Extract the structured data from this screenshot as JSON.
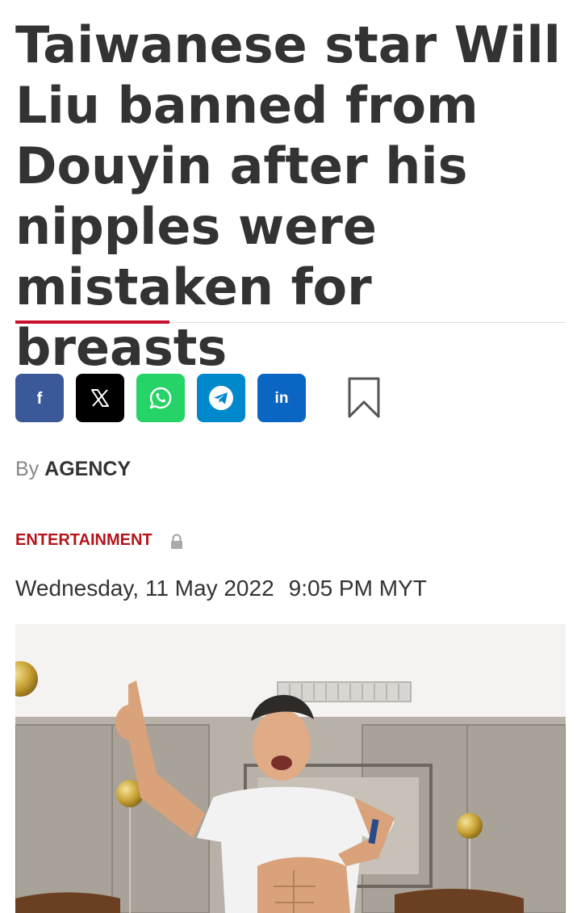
{
  "article": {
    "headline": "Taiwanese star Will Liu banned from Douyin after his nipples were mistaken for breasts",
    "byline_prefix": "By",
    "author": "AGENCY",
    "category": "ENTERTAINMENT",
    "date": "Wednesday, 11 May 2022",
    "time": "9:05 PM MYT"
  },
  "share": {
    "buttons": [
      {
        "name": "facebook",
        "icon": "facebook-icon",
        "color": "#3b5998"
      },
      {
        "name": "x",
        "icon": "x-icon",
        "color": "#000000"
      },
      {
        "name": "whatsapp",
        "icon": "whatsapp-icon",
        "color": "#25d366"
      },
      {
        "name": "telegram",
        "icon": "telegram-icon",
        "color": "#0088cc"
      },
      {
        "name": "linkedin",
        "icon": "linkedin-icon",
        "color": "#0a66c2"
      }
    ],
    "bookmark_icon": "bookmark-icon"
  },
  "colors": {
    "accent": "#c8102e",
    "category": "#b3141a",
    "text": "#333333"
  },
  "image": {
    "subject": "man lifting white t-shirt, pointing up, gold balloons in room"
  }
}
